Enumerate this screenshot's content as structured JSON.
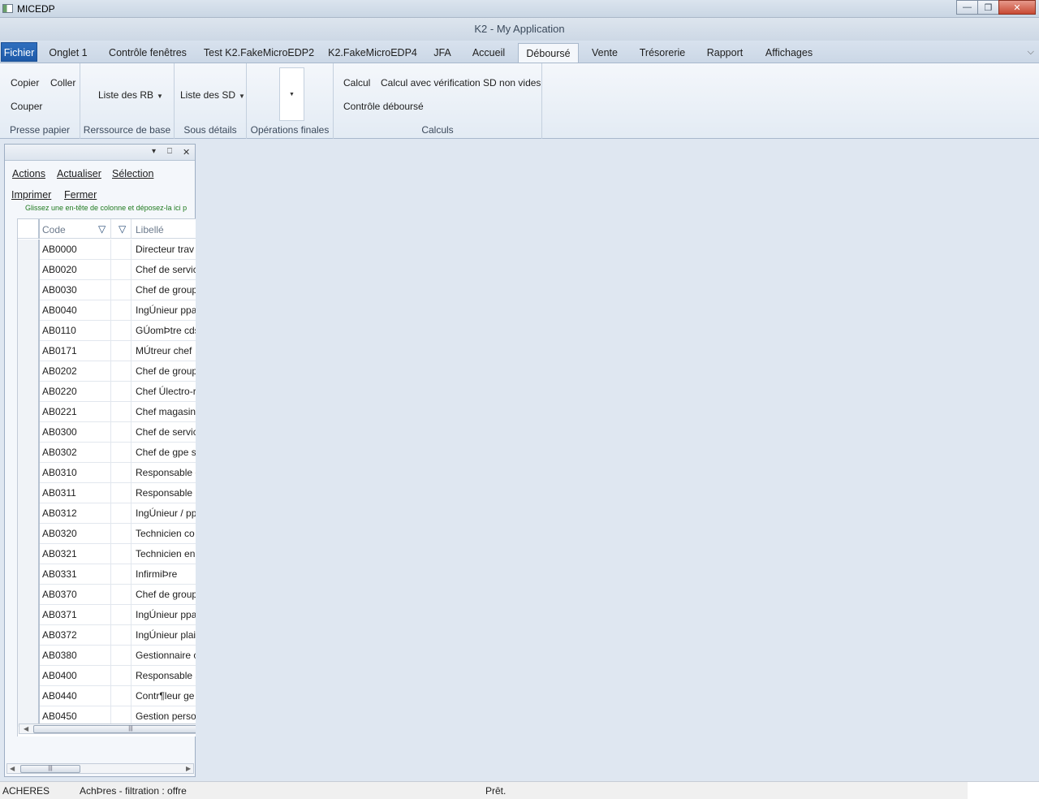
{
  "os_window": {
    "title": "MICEDP",
    "minimize": "—",
    "maximize": "❐",
    "close": "✕"
  },
  "app": {
    "title": "K2 - My Application"
  },
  "tabs": [
    {
      "label": "Fichier"
    },
    {
      "label": "Onglet 1"
    },
    {
      "label": "Contrôle fenêtres"
    },
    {
      "label": "Test K2.FakeMicroEDP2"
    },
    {
      "label": "K2.FakeMicroEDP4"
    },
    {
      "label": "JFA"
    },
    {
      "label": "Accueil"
    },
    {
      "label": "Déboursé"
    },
    {
      "label": "Vente"
    },
    {
      "label": "Trésorerie"
    },
    {
      "label": "Rapport"
    },
    {
      "label": "Affichages"
    }
  ],
  "active_tab": "Déboursé",
  "ribbon": {
    "collapse_icon": "chevron-down",
    "clipboard": {
      "title": "Presse papier",
      "copy": "Copier",
      "paste": "Coller",
      "cut": "Couper"
    },
    "base_resource": {
      "title": "Rerssource de base",
      "list": "Liste des RB"
    },
    "sub_details": {
      "title": "Sous détails",
      "list": "Liste des SD"
    },
    "final_ops": {
      "title": "Opérations finales"
    },
    "calculs": {
      "title": "Calculs",
      "calcul": "Calcul",
      "calcul_check": "Calcul avec vérification SD non vides",
      "controle": "Contrôle déboursé"
    }
  },
  "panel": {
    "menu": {
      "actions": "Actions",
      "refresh": "Actualiser",
      "selection": "Sélection",
      "print": "Imprimer",
      "close": "Fermer"
    },
    "group_hint": "Glissez une en-tête de colonne et déposez-la ici p",
    "header_buttons": {
      "dropdown": "▾",
      "pin": "⎕",
      "close": "✕"
    },
    "grid": {
      "columns": {
        "code": "Code",
        "libelle": "Libellé"
      },
      "rows": [
        {
          "code": "AB0000",
          "libelle": "Directeur trav"
        },
        {
          "code": "AB0020",
          "libelle": "Chef de servic"
        },
        {
          "code": "AB0030",
          "libelle": "Chef de group"
        },
        {
          "code": "AB0040",
          "libelle": "IngÚnieur ppa"
        },
        {
          "code": "AB0110",
          "libelle": "GÚomÞtre cds"
        },
        {
          "code": "AB0171",
          "libelle": "MÚtreur chef"
        },
        {
          "code": "AB0202",
          "libelle": "Chef de group"
        },
        {
          "code": "AB0220",
          "libelle": "Chef Úlectro-r"
        },
        {
          "code": "AB0221",
          "libelle": "Chef magasin"
        },
        {
          "code": "AB0300",
          "libelle": "Chef de servic"
        },
        {
          "code": "AB0302",
          "libelle": "Chef de gpe s"
        },
        {
          "code": "AB0310",
          "libelle": "Responsable c"
        },
        {
          "code": "AB0311",
          "libelle": "Responsable h"
        },
        {
          "code": "AB0312",
          "libelle": "IngÚnieur / pp"
        },
        {
          "code": "AB0320",
          "libelle": "Technicien co"
        },
        {
          "code": "AB0321",
          "libelle": "Technicien en"
        },
        {
          "code": "AB0331",
          "libelle": "InfirmiÞre"
        },
        {
          "code": "AB0370",
          "libelle": "Chef de group"
        },
        {
          "code": "AB0371",
          "libelle": "IngÚnieur ppa"
        },
        {
          "code": "AB0372",
          "libelle": "IngÚnieur plai"
        },
        {
          "code": "AB0380",
          "libelle": "Gestionnaire c"
        },
        {
          "code": "AB0400",
          "libelle": "Responsable a"
        },
        {
          "code": "AB0440",
          "libelle": "Contr¶leur ge"
        },
        {
          "code": "AB0450",
          "libelle": "Gestion perso"
        }
      ]
    }
  },
  "status": {
    "site": "ACHERES",
    "filter": "AchÞres - filtration : offre",
    "state": "Prêt."
  }
}
